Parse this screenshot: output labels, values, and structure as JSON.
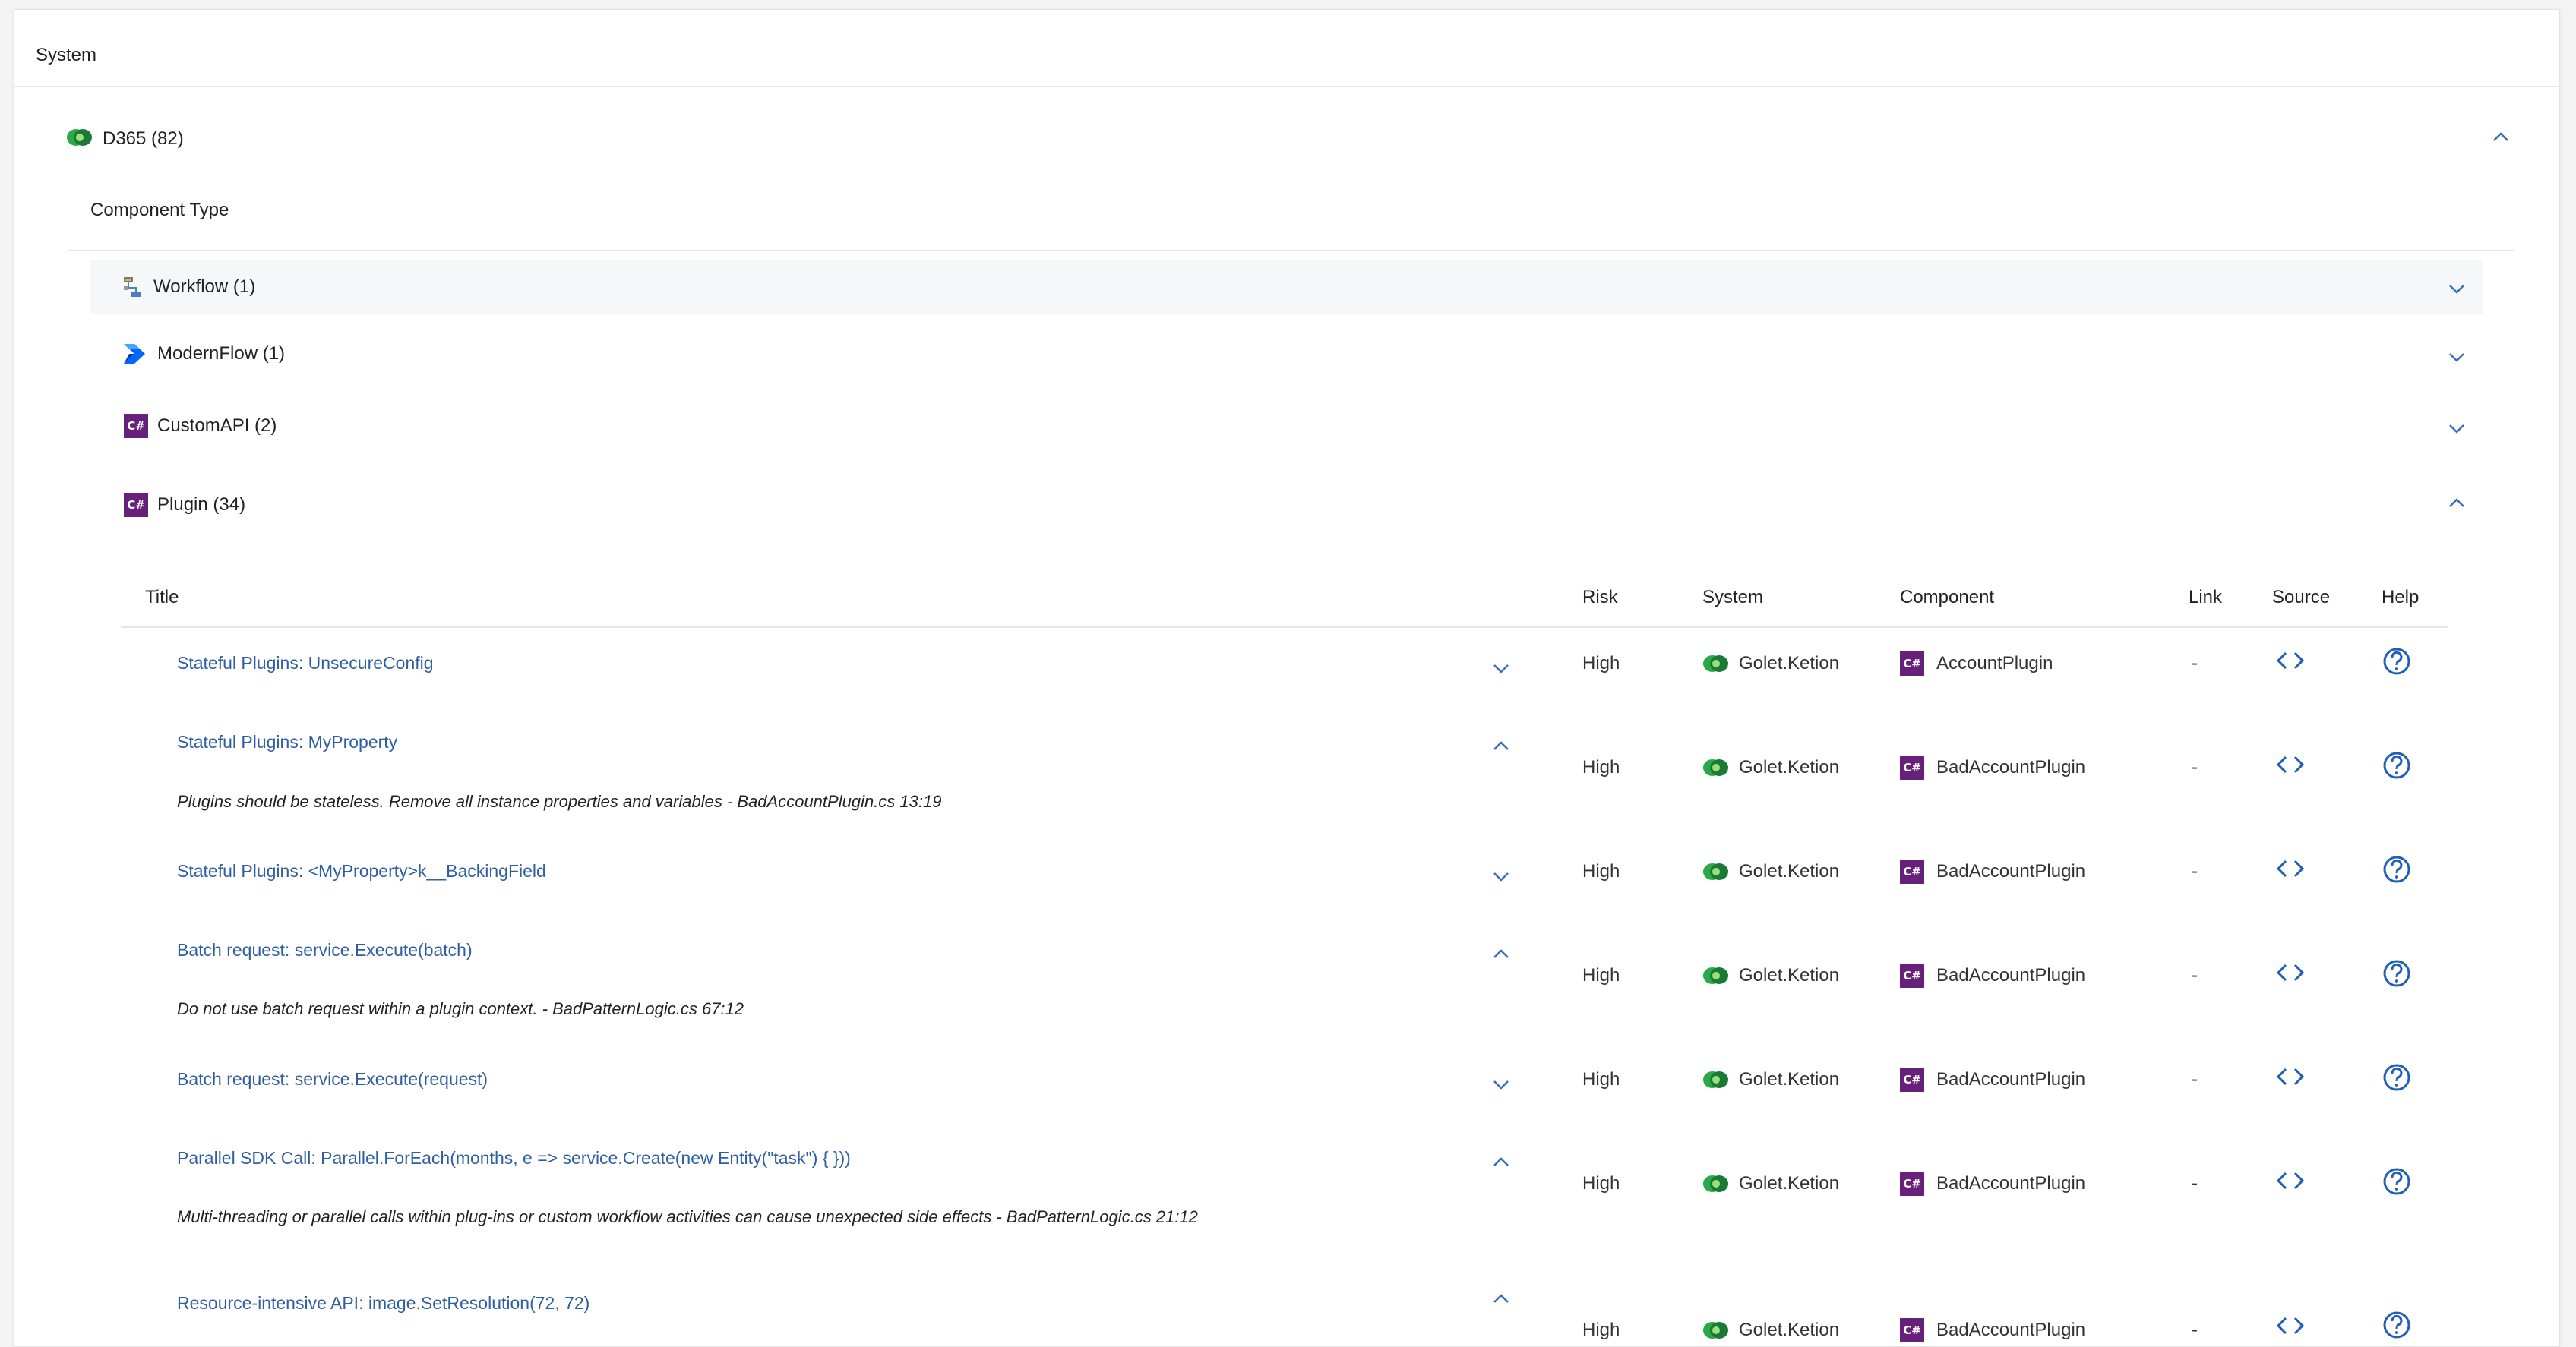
{
  "header": {
    "title": "System"
  },
  "system_group": {
    "label": "D365 (82)"
  },
  "component_type_title": "Component Type",
  "components": [
    {
      "label": "Workflow (1)",
      "icon": "workflow-icon"
    },
    {
      "label": "ModernFlow (1)",
      "icon": "power-automate-icon"
    },
    {
      "label": "CustomAPI (2)",
      "icon": "csharp-icon"
    },
    {
      "label": "Plugin (34)",
      "icon": "csharp-icon"
    }
  ],
  "table": {
    "columns": [
      "Title",
      "Risk",
      "System",
      "Component",
      "Link",
      "Source",
      "Help"
    ],
    "rows": [
      {
        "title": "Stateful Plugins: UnsecureConfig",
        "expanded": false,
        "description": "",
        "risk": "High",
        "system": "Golet.Ketion",
        "component": "AccountPlugin",
        "link": "-"
      },
      {
        "title": "Stateful Plugins: MyProperty",
        "expanded": true,
        "description": "Plugins should be stateless. Remove all instance properties and variables - BadAccountPlugin.cs 13:19",
        "risk": "High",
        "system": "Golet.Ketion",
        "component": "BadAccountPlugin",
        "link": "-"
      },
      {
        "title": "Stateful Plugins: <MyProperty>k__BackingField",
        "expanded": false,
        "description": "",
        "risk": "High",
        "system": "Golet.Ketion",
        "component": "BadAccountPlugin",
        "link": "-"
      },
      {
        "title": "Batch request: service.Execute(batch)",
        "expanded": true,
        "description": "Do not use batch request within a plugin context. - BadPatternLogic.cs 67:12",
        "risk": "High",
        "system": "Golet.Ketion",
        "component": "BadAccountPlugin",
        "link": "-"
      },
      {
        "title": "Batch request: service.Execute(request)",
        "expanded": false,
        "description": "",
        "risk": "High",
        "system": "Golet.Ketion",
        "component": "BadAccountPlugin",
        "link": "-"
      },
      {
        "title": "Parallel SDK Call: Parallel.ForEach(months, e => service.Create(new Entity(\"task\") { }))",
        "expanded": true,
        "description": "Multi-threading or parallel calls within plug-ins or custom workflow activities can cause unexpected side effects - BadPatternLogic.cs 21:12",
        "risk": "High",
        "system": "Golet.Ketion",
        "component": "BadAccountPlugin",
        "link": "-"
      },
      {
        "title": "Resource-intensive API: image.SetResolution(72, 72)",
        "expanded": true,
        "description": "",
        "risk": "High",
        "system": "Golet.Ketion",
        "component": "BadAccountPlugin",
        "link": "-"
      }
    ]
  },
  "colors": {
    "link": "#2f5fa3",
    "csharp": "#68217a",
    "d365_green": "#1e8f3e",
    "divider": "#e6e6e6"
  }
}
